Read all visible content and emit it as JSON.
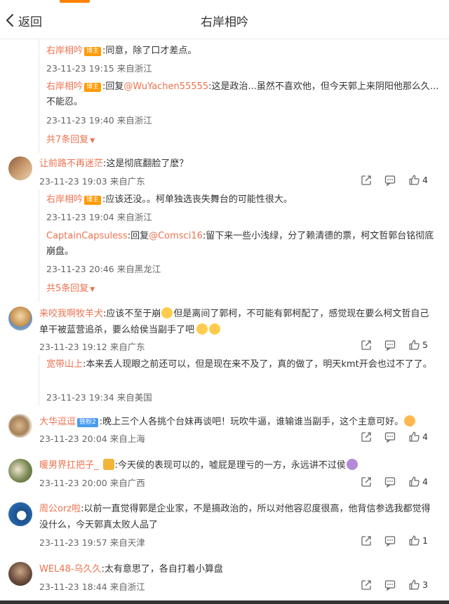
{
  "header": {
    "back_label": "返回",
    "title": "右岸相吟"
  },
  "thread1": {
    "replies": [
      {
        "user": "右岸相吟",
        "badge": "博主",
        "prefix": ":",
        "text": "同意，除了口才差点。",
        "meta": "23-11-23 19:15 来自浙江"
      },
      {
        "user": "右岸相吟",
        "badge": "博主",
        "prefix": ":回复",
        "mention": "@WuYachen55555",
        "text": ":这是政治...虽然不喜欢他，但今天郭上来阴阳他那么久...不能忍。",
        "meta": "23-11-23 19:40 来自浙江"
      }
    ],
    "more": "共7条回复"
  },
  "comments": [
    {
      "user": "让前路不再迷茫",
      "text": ":这是彻底翻脸了麽？",
      "meta": "23-11-23 19:03 来自广东",
      "likes": "4",
      "replies": [
        {
          "user": "右岸相吟",
          "badge": "博主",
          "prefix": ":",
          "text": "应该还没。。柯单独选丧失舞台的可能性很大。",
          "meta": "23-11-23 19:04 来自浙江"
        },
        {
          "user": "CaptainCapsuless",
          "prefix": ":回复",
          "mention": "@Comsci16",
          "text": ":留下来一些小浅绿，分了赖清德的票，柯文哲郭台铭彻底崩盘。",
          "meta": "23-11-23 20:46 来自黑龙江"
        }
      ],
      "more": "共5条回复"
    },
    {
      "user": "来咬我啊牧羊犬",
      "text": ":应该不至于崩",
      "text2": "但是离间了郭柯，不可能有郭柯配了，感觉现在要么柯文哲自己单干被蓝营追杀，要么给侯当副手了吧",
      "meta": "23-11-23 19:12 来自广东",
      "likes": "5",
      "replies": [
        {
          "user": "宽带山上",
          "prefix": ":",
          "text": "本来丢人现眼之前还可以，但是现在来不及了，真的做了，明天kmt开会也过不了了。",
          "meta": "23-11-23 19:34 来自美国"
        }
      ]
    },
    {
      "user": "大华逗逗",
      "badge": "铁粉2",
      "text": ":晚上三个人各挑个台妹再谈吧！玩吹牛逼，谁输谁当副手，这个主意可好。",
      "meta": "23-11-23 20:04 来自上海",
      "likes": "4"
    },
    {
      "user": "暖男界扛把子_",
      "text": ":今天侯的表现可以的，嘘屁是理亏的一方，永远讲不过侯",
      "meta": "23-11-23 20:00 来自广西",
      "likes": "4"
    },
    {
      "user": "周公orz啦",
      "text": ":以前一直觉得郭是企业家，不是搞政治的，所以对他容忍度很高，他背信参选我都觉得没什么，今天郭真太败人品了",
      "meta": "23-11-23 19:57 来自天津",
      "likes": "1"
    },
    {
      "user": "WEL48-乌久久",
      "text": ":太有意思了，各自打着小算盘",
      "meta": "23-11-23 18:44 来自浙江",
      "likes": "3"
    }
  ],
  "colors": {
    "accent": "#ff8200",
    "username": "#eb7350",
    "badge_blogger": "#ff9a00",
    "badge_fan": "#4a9bf0"
  },
  "icons": {
    "back": "chevron-left-icon",
    "share": "share-icon",
    "comment": "comment-icon",
    "like": "thumbs-up-icon"
  }
}
